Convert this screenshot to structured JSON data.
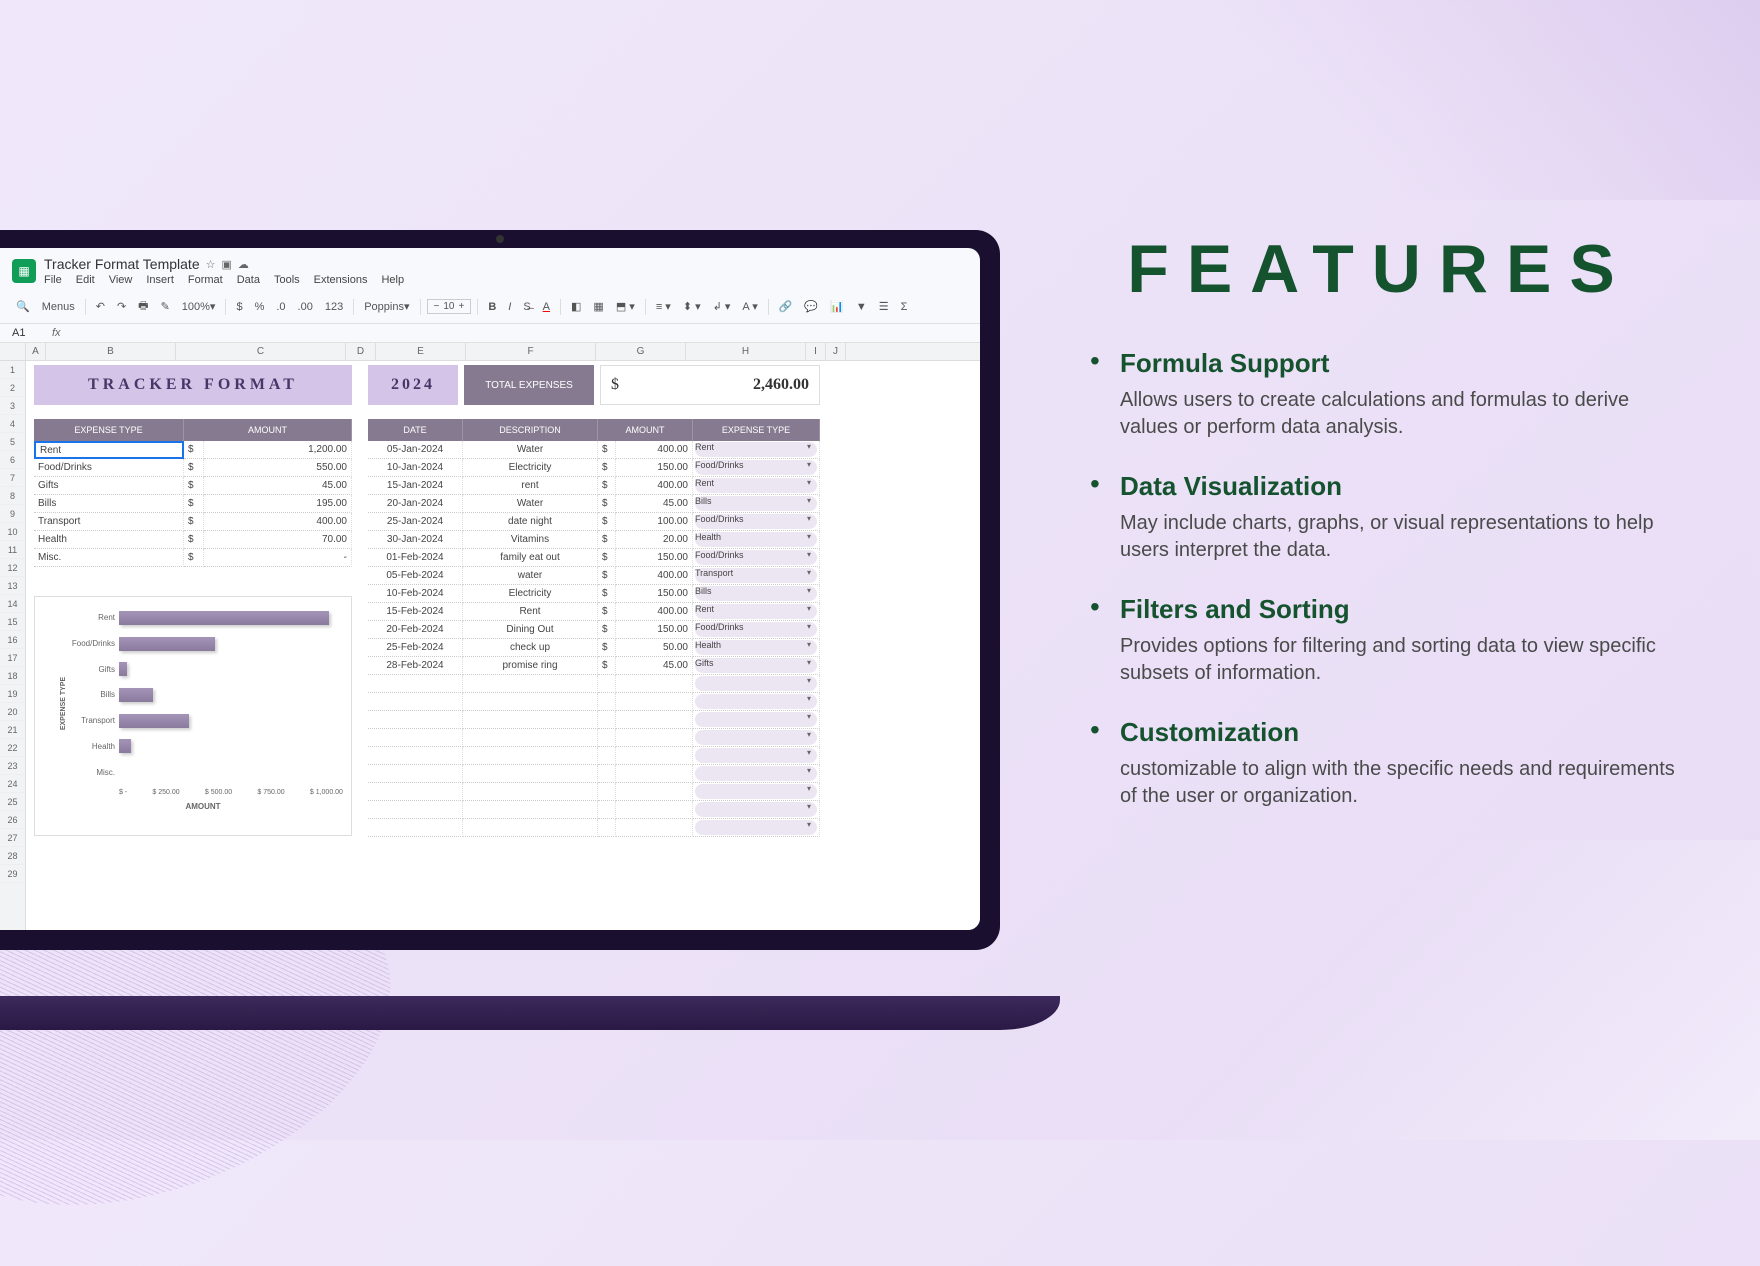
{
  "doc_title": "Tracker Format Template",
  "menus": [
    "File",
    "Edit",
    "View",
    "Insert",
    "Format",
    "Data",
    "Tools",
    "Extensions",
    "Help"
  ],
  "toolbar": {
    "search": "Menus",
    "zoom": "100%",
    "font": "Poppins",
    "fontsize": "10",
    "currency": "$",
    "percent": "%",
    "decimal1": ".0",
    "decimal2": ".00",
    "numfmt": "123"
  },
  "cell_ref": "A1",
  "fx": "fx",
  "cols": [
    {
      "l": "",
      "w": 26
    },
    {
      "l": "A",
      "w": 20
    },
    {
      "l": "B",
      "w": 130
    },
    {
      "l": "C",
      "w": 170
    },
    {
      "l": "D",
      "w": 30
    },
    {
      "l": "E",
      "w": 90
    },
    {
      "l": "F",
      "w": 130
    },
    {
      "l": "G",
      "w": 90
    },
    {
      "l": "H",
      "w": 120
    },
    {
      "l": "I",
      "w": 20
    },
    {
      "l": "J",
      "w": 20
    }
  ],
  "row_nums": [
    "1",
    "2",
    "3",
    "4",
    "5",
    "6",
    "7",
    "8",
    "9",
    "10",
    "11",
    "12",
    "13",
    "14",
    "15",
    "16",
    "17",
    "18",
    "19",
    "20",
    "21",
    "22",
    "23",
    "24",
    "25",
    "26",
    "27",
    "28",
    "29"
  ],
  "tracker": {
    "title": "TRACKER FORMAT",
    "year": "2024",
    "total_label": "TOTAL EXPENSES",
    "total_currency": "$",
    "total_value": "2,460.00"
  },
  "left_headers": [
    "EXPENSE TYPE",
    "AMOUNT"
  ],
  "left_rows": [
    {
      "type": "Rent",
      "amt": "1,200.00"
    },
    {
      "type": "Food/Drinks",
      "amt": "550.00"
    },
    {
      "type": "Gifts",
      "amt": "45.00"
    },
    {
      "type": "Bills",
      "amt": "195.00"
    },
    {
      "type": "Transport",
      "amt": "400.00"
    },
    {
      "type": "Health",
      "amt": "70.00"
    },
    {
      "type": "Misc.",
      "amt": "-"
    }
  ],
  "right_headers": [
    "DATE",
    "DESCRIPTION",
    "AMOUNT",
    "EXPENSE TYPE"
  ],
  "right_rows": [
    {
      "d": "05-Jan-2024",
      "desc": "Water",
      "amt": "400.00",
      "et": "Rent"
    },
    {
      "d": "10-Jan-2024",
      "desc": "Electricity",
      "amt": "150.00",
      "et": "Food/Drinks"
    },
    {
      "d": "15-Jan-2024",
      "desc": "rent",
      "amt": "400.00",
      "et": "Rent"
    },
    {
      "d": "20-Jan-2024",
      "desc": "Water",
      "amt": "45.00",
      "et": "Bills"
    },
    {
      "d": "25-Jan-2024",
      "desc": "date night",
      "amt": "100.00",
      "et": "Food/Drinks"
    },
    {
      "d": "30-Jan-2024",
      "desc": "Vitamins",
      "amt": "20.00",
      "et": "Health"
    },
    {
      "d": "01-Feb-2024",
      "desc": "family eat out",
      "amt": "150.00",
      "et": "Food/Drinks"
    },
    {
      "d": "05-Feb-2024",
      "desc": "water",
      "amt": "400.00",
      "et": "Transport"
    },
    {
      "d": "10-Feb-2024",
      "desc": "Electricity",
      "amt": "150.00",
      "et": "Bills"
    },
    {
      "d": "15-Feb-2024",
      "desc": "Rent",
      "amt": "400.00",
      "et": "Rent"
    },
    {
      "d": "20-Feb-2024",
      "desc": "Dining Out",
      "amt": "150.00",
      "et": "Food/Drinks"
    },
    {
      "d": "25-Feb-2024",
      "desc": "check up",
      "amt": "50.00",
      "et": "Health"
    },
    {
      "d": "28-Feb-2024",
      "desc": "promise ring",
      "amt": "45.00",
      "et": "Gifts"
    }
  ],
  "empty_dd_rows": 9,
  "chart_data": {
    "type": "bar",
    "orientation": "horizontal",
    "title": "",
    "xlabel": "AMOUNT",
    "ylabel": "EXPENSE TYPE",
    "categories": [
      "Rent",
      "Food/Drinks",
      "Gifts",
      "Bills",
      "Transport",
      "Health",
      "Misc."
    ],
    "values": [
      1200,
      550,
      45,
      195,
      400,
      70,
      0
    ],
    "xticks": [
      "$ -",
      "$ 250.00",
      "$ 500.00",
      "$ 750.00",
      "$ 1,000.00"
    ],
    "xlim": [
      0,
      1200
    ]
  },
  "features": {
    "title": "FEATURES",
    "items": [
      {
        "h": "Formula Support",
        "p": "Allows users to create calculations and formulas to derive values or perform data analysis."
      },
      {
        "h": "Data Visualization",
        "p": "May include charts, graphs, or visual representations to help users interpret the data."
      },
      {
        "h": "Filters and Sorting",
        "p": "Provides options for filtering and sorting data to view specific subsets of information."
      },
      {
        "h": "Customization",
        "p": "customizable to align with the specific needs and requirements of the user or organization."
      }
    ]
  }
}
